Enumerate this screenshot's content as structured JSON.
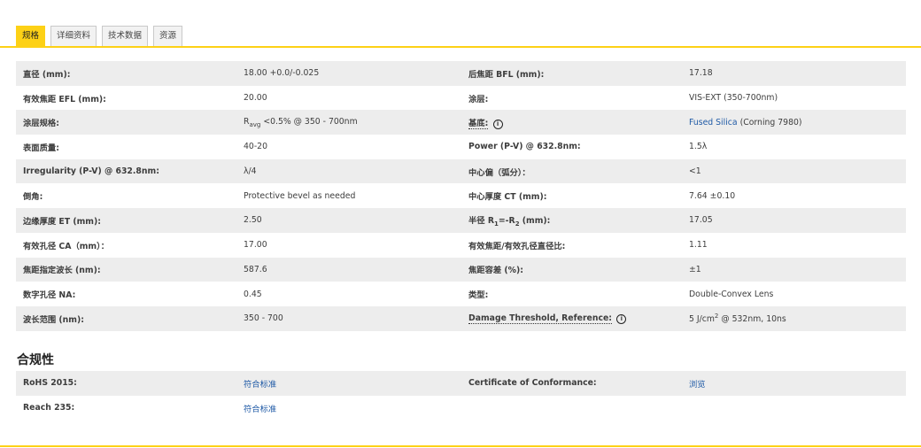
{
  "tabs": [
    "规格",
    "详细资料",
    "技术数据",
    "资源"
  ],
  "specs": [
    {
      "l1": "直径 (mm):",
      "v1": "18.00 +0.0/-0.025",
      "l2": "后焦距 BFL (mm):",
      "v2": "17.18"
    },
    {
      "l1": "有效焦距 EFL (mm):",
      "v1": "20.00",
      "l2": "涂层:",
      "v2": "VIS-EXT (350-700nm)"
    },
    {
      "l1": "涂层规格:",
      "v1_pre": "R",
      "v1_sub": "avg",
      "v1_post": " <0.5% @ 350 - 700nm",
      "l2": "基底:",
      "v2_link": "Fused Silica",
      "v2_post": " (Corning 7980)"
    },
    {
      "l1": "表面质量:",
      "v1": "40-20",
      "l2": "Power (P-V) @ 632.8nm:",
      "v2": "1.5λ"
    },
    {
      "l1": "Irregularity (P-V) @ 632.8nm:",
      "v1": "λ/4",
      "l2": "中心偏（弧分）：",
      "v2": "<1"
    },
    {
      "l1": "倒角:",
      "v1": "Protective bevel as needed",
      "l2": "中心厚度 CT (mm):",
      "v2": "7.64 ±0.10"
    },
    {
      "l1": "边缘厚度 ET (mm):",
      "v1": "2.50",
      "l2_pre": "半径 R",
      "l2_sub1": "1",
      "l2_mid": "=-R",
      "l2_sub2": "2",
      "l2_post": " (mm):",
      "v2": "17.05"
    },
    {
      "l1": "有效孔径 CA（mm）：",
      "v1": "17.00",
      "l2": "有效焦距/有效孔径直径比:",
      "v2": "1.11"
    },
    {
      "l1": "焦距指定波长 (nm):",
      "v1": "587.6",
      "l2": "焦距容差 (%):",
      "v2": "±1"
    },
    {
      "l1": "数字孔径 NA:",
      "v1": "0.45",
      "l2": "类型:",
      "v2": "Double-Convex Lens"
    },
    {
      "l1": "波长范围 (nm):",
      "v1": "350 - 700",
      "l2": "Damage Threshold, Reference:",
      "v2_pre": "5 J/cm",
      "v2_sup": "2",
      "v2_post": " @ 532nm, 10ns"
    }
  ],
  "info_glyph": "i",
  "compliance": {
    "title": "合规性",
    "rows": [
      {
        "l1": "RoHS 2015:",
        "v1": "符合标准",
        "l2": "Certificate of Conformance:",
        "v2": "浏览"
      },
      {
        "l1": "Reach 235:",
        "v1": "符合标准",
        "l2": "",
        "v2": ""
      }
    ]
  },
  "colors": {
    "accent": "#fdd116",
    "link": "#1f5aa6",
    "row_alt": "#ededed"
  }
}
